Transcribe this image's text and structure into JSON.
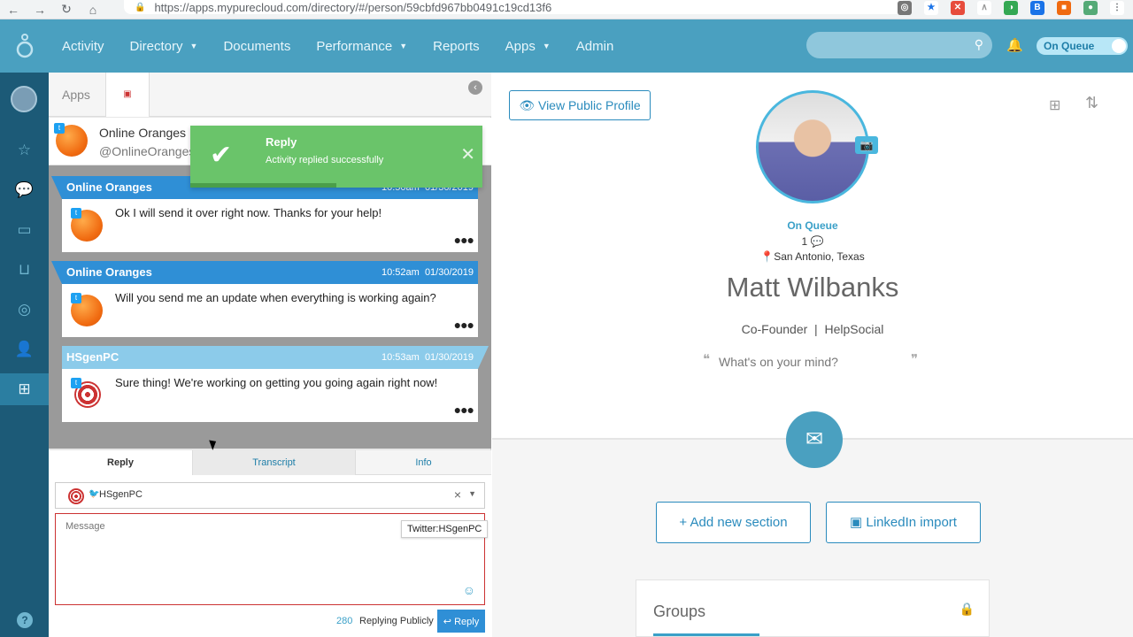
{
  "browser": {
    "url": "https://apps.mypurecloud.com/directory/#/person/59cbfd967bb0491c19cd13f6"
  },
  "topnav": {
    "items": [
      {
        "label": "Activity",
        "dropdown": false
      },
      {
        "label": "Directory",
        "dropdown": true
      },
      {
        "label": "Documents",
        "dropdown": false
      },
      {
        "label": "Performance",
        "dropdown": true
      },
      {
        "label": "Reports",
        "dropdown": false
      },
      {
        "label": "Apps",
        "dropdown": true
      },
      {
        "label": "Admin",
        "dropdown": false
      }
    ],
    "status_toggle": "On Queue"
  },
  "apps_panel": {
    "tab_label": "Apps",
    "conversation": {
      "name": "Online Oranges",
      "handle": "@OnlineOranges"
    },
    "toast": {
      "title": "Reply",
      "message": "Activity replied successfully",
      "progress_percent": 50
    },
    "messages": [
      {
        "sender": "Online Oranges",
        "time": "10:50am",
        "date": "01/30/2019",
        "text": "Ok I will send it over right now. Thanks for your help!",
        "avatar": "orange"
      },
      {
        "sender": "Online Oranges",
        "time": "10:52am",
        "date": "01/30/2019",
        "text": "Will you send me an update when everything is working again?",
        "avatar": "orange"
      },
      {
        "sender": "HSgenPC",
        "time": "10:53am",
        "date": "01/30/2019",
        "text": "Sure thing! We're working on getting you going again right now!",
        "avatar": "target"
      }
    ],
    "reply_tabs": {
      "reply": "Reply",
      "transcript": "Transcript",
      "info": "Info"
    },
    "reply": {
      "recipient": "HSgenPC",
      "message_placeholder": "Message",
      "tooltip": "Twitter:HSgenPC",
      "char_count": "280",
      "mode": "Replying Publicly",
      "button": "Reply"
    }
  },
  "profile": {
    "view_public_profile": "View Public Profile",
    "status": "On Queue",
    "chat_count": "1",
    "location": "San Antonio, Texas",
    "name": "Matt Wilbanks",
    "role": "Co-Founder",
    "company": "HelpSocial",
    "mind_placeholder": "What's on your mind?",
    "add_section": "+ Add new section",
    "linkedin_import": "LinkedIn import",
    "groups_title": "Groups"
  },
  "colors": {
    "topnav": "#4aa0c0",
    "rail": "#1c5a77",
    "accent": "#2a8bbd",
    "toast": "#6ac46a",
    "message_header": "#2f8fd6"
  }
}
